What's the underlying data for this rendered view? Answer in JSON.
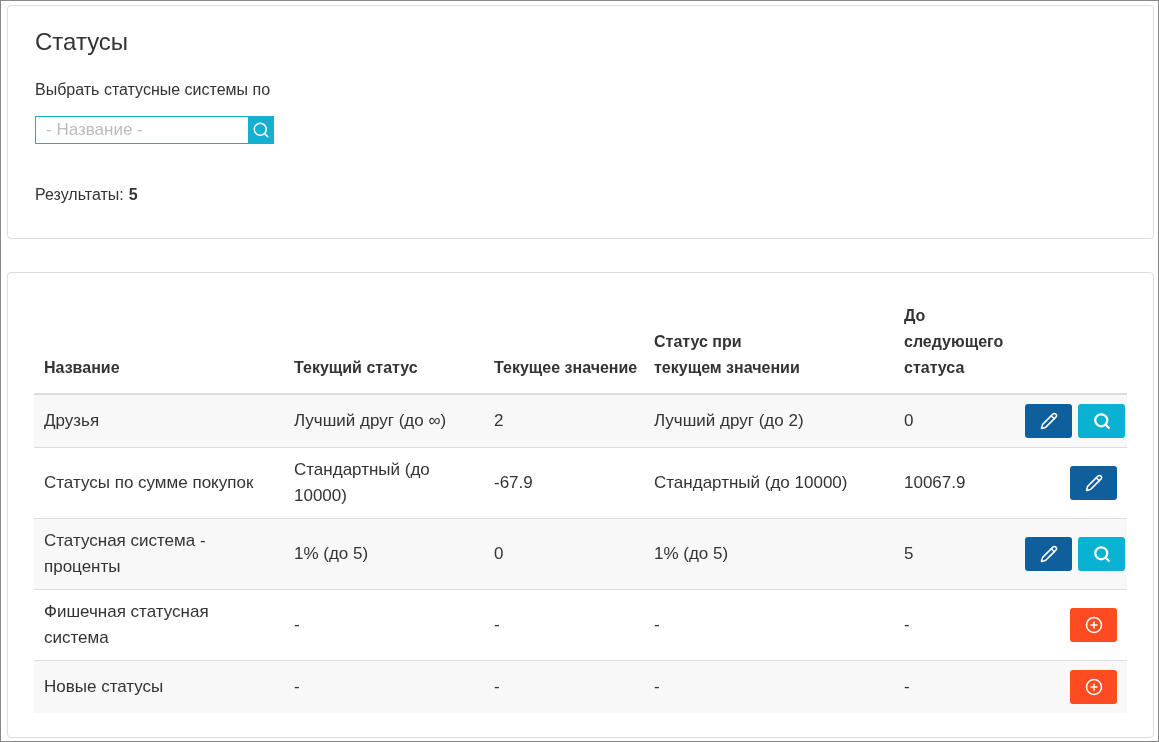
{
  "filter_panel": {
    "title": "Статусы",
    "filter_label": "Выбрать статусные системы по",
    "search": {
      "placeholder": "- Название -"
    },
    "results_label": "Результаты:",
    "results_count": "5"
  },
  "table": {
    "columns": [
      "Название",
      "Текущий статус",
      "Текущее значение",
      "Статус при текущем значении",
      "До следующего статуса"
    ],
    "rows": [
      {
        "cells": [
          "Друзья",
          "Лучший друг (до ∞)",
          "2",
          "Лучший друг (до 2)",
          "0"
        ],
        "actions": [
          {
            "kind": "edit"
          },
          {
            "kind": "view"
          }
        ]
      },
      {
        "cells": [
          "Статусы по сумме покупок",
          "Стандартный (до 10000)",
          "-67.9",
          "Стандартный (до 10000)",
          "10067.9"
        ],
        "actions": [
          {
            "kind": "edit"
          }
        ]
      },
      {
        "cells": [
          "Статусная система - проценты",
          "1% (до 5)",
          "0",
          "1% (до 5)",
          "5"
        ],
        "actions": [
          {
            "kind": "edit"
          },
          {
            "kind": "view"
          }
        ]
      },
      {
        "cells": [
          "Фишечная статусная система",
          "-",
          "-",
          "-",
          "-"
        ],
        "actions": [
          {
            "kind": "add"
          }
        ]
      },
      {
        "cells": [
          "Новые статусы",
          "-",
          "-",
          "-",
          "-"
        ],
        "actions": [
          {
            "kind": "add"
          }
        ]
      }
    ]
  }
}
